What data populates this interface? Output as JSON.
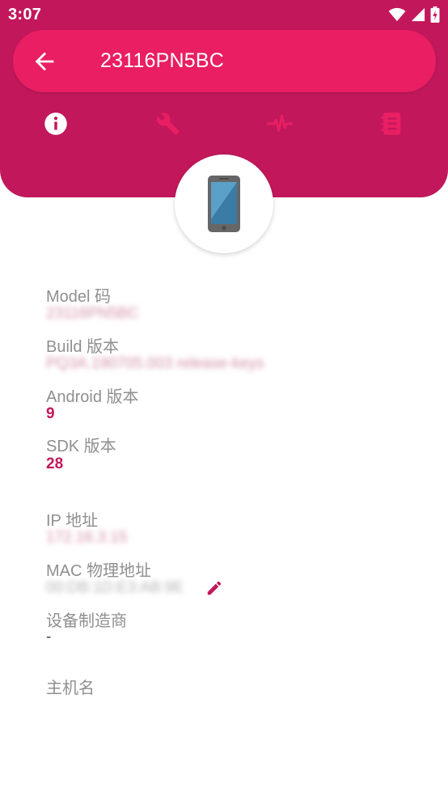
{
  "status_bar": {
    "time": "3:07"
  },
  "toolbar": {
    "title": "23116PN5BC"
  },
  "tabs": [
    {
      "icon": "info-icon",
      "active": true
    },
    {
      "icon": "wrench-icon",
      "active": false
    },
    {
      "icon": "pulse-icon",
      "active": false
    },
    {
      "icon": "notebook-icon",
      "active": false
    }
  ],
  "colors": {
    "primary": "#E91E63",
    "primary_dark": "#C2185B",
    "label_gray": "#8f8f8f"
  },
  "device": {
    "model_label": "Model 码",
    "model_value": "23116PN5BC",
    "build_label": "Build 版本",
    "build_value": "PQ3A.190705.003 release-keys",
    "android_label": "Android 版本",
    "android_value": "9",
    "sdk_label": "SDK 版本",
    "sdk_value": "28"
  },
  "network": {
    "ip_label": "IP 地址",
    "ip_value": "172.16.3.15",
    "mac_label": "MAC 物理地址",
    "mac_value": "00:DB:1D:E3:AB:9E",
    "manufacturer_label": "设备制造商",
    "manufacturer_value": "-",
    "hostname_label": "主机名"
  }
}
